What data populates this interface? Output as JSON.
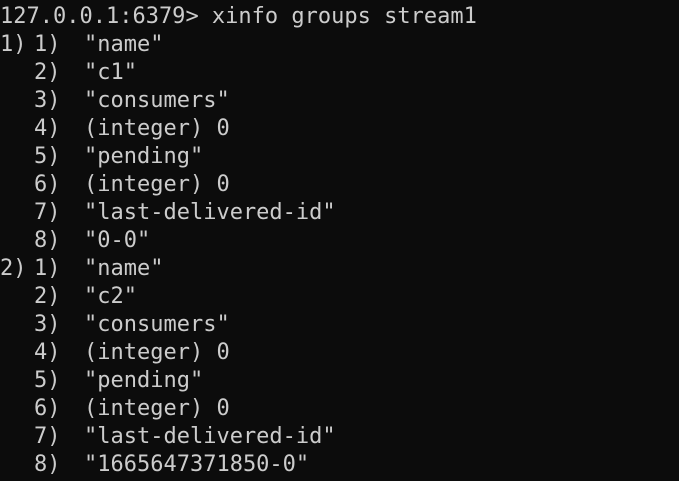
{
  "prompt": {
    "host": "127.0.0.1:6379",
    "separator": ">",
    "command": " xinfo groups stream1"
  },
  "output": [
    {
      "outer_index": "1)",
      "items": [
        {
          "index": "1)",
          "value": "\"name\""
        },
        {
          "index": "2)",
          "value": "\"c1\""
        },
        {
          "index": "3)",
          "value": "\"consumers\""
        },
        {
          "index": "4)",
          "value": "(integer) 0"
        },
        {
          "index": "5)",
          "value": "\"pending\""
        },
        {
          "index": "6)",
          "value": "(integer) 0"
        },
        {
          "index": "7)",
          "value": "\"last-delivered-id\""
        },
        {
          "index": "8)",
          "value": "\"0-0\""
        }
      ]
    },
    {
      "outer_index": "2)",
      "items": [
        {
          "index": "1)",
          "value": "\"name\""
        },
        {
          "index": "2)",
          "value": "\"c2\""
        },
        {
          "index": "3)",
          "value": "\"consumers\""
        },
        {
          "index": "4)",
          "value": "(integer) 0"
        },
        {
          "index": "5)",
          "value": "\"pending\""
        },
        {
          "index": "6)",
          "value": "(integer) 0"
        },
        {
          "index": "7)",
          "value": "\"last-delivered-id\""
        },
        {
          "index": "8)",
          "value": "\"1665647371850-0\""
        }
      ]
    }
  ],
  "colors": {
    "background": "#0c0c0c",
    "text": "#cccccc"
  }
}
